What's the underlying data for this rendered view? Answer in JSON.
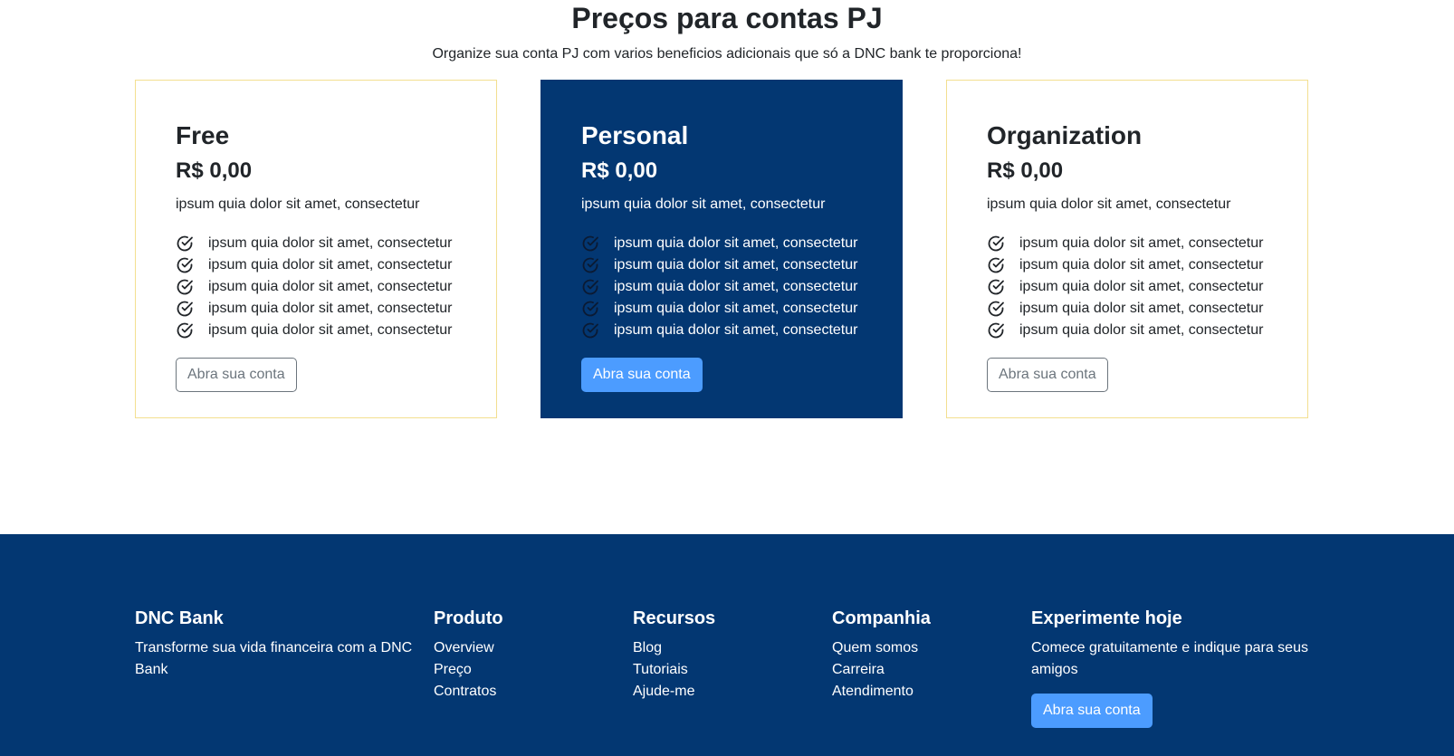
{
  "pricing": {
    "title": "Preços para contas PJ",
    "subtitle": "Organize sua conta PJ com varios beneficios adicionais que só a DNC bank te proporciona!",
    "plans": [
      {
        "name": "Free",
        "price": "R$ 0,00",
        "description": "ipsum quia dolor sit amet, consectetur",
        "features": [
          "ipsum quia dolor sit amet, consectetur",
          "ipsum quia dolor sit amet, consectetur",
          "ipsum quia dolor sit amet, consectetur",
          "ipsum quia dolor sit amet, consectetur",
          "ipsum quia dolor sit amet, consectetur"
        ],
        "button_label": "Abra sua conta"
      },
      {
        "name": "Personal",
        "price": "R$ 0,00",
        "description": "ipsum quia dolor sit amet, consectetur",
        "features": [
          "ipsum quia dolor sit amet, consectetur",
          "ipsum quia dolor sit amet, consectetur",
          "ipsum quia dolor sit amet, consectetur",
          "ipsum quia dolor sit amet, consectetur",
          "ipsum quia dolor sit amet, consectetur"
        ],
        "button_label": "Abra sua conta"
      },
      {
        "name": "Organization",
        "price": "R$ 0,00",
        "description": "ipsum quia dolor sit amet, consectetur",
        "features": [
          "ipsum quia dolor sit amet, consectetur",
          "ipsum quia dolor sit amet, consectetur",
          "ipsum quia dolor sit amet, consectetur",
          "ipsum quia dolor sit amet, consectetur",
          "ipsum quia dolor sit amet, consectetur"
        ],
        "button_label": "Abra sua conta"
      }
    ],
    "icons": {
      "feature": "check-circle-icon"
    }
  },
  "footer": {
    "brand": {
      "title": "DNC Bank",
      "text": "Transforme sua vida financeira com a DNC Bank"
    },
    "produto": {
      "title": "Produto",
      "links": [
        "Overview",
        "Preço",
        "Contratos"
      ]
    },
    "recursos": {
      "title": "Recursos",
      "links": [
        "Blog",
        "Tutoriais",
        "Ajude-me"
      ]
    },
    "companhia": {
      "title": "Companhia",
      "links": [
        "Quem somos",
        "Carreira",
        "Atendimento"
      ]
    },
    "cta": {
      "title": "Experimente hoje",
      "text": "Comece gratuitamente e indique para seus amigos",
      "button_label": "Abra sua conta"
    }
  },
  "colors": {
    "primary_dark": "#033772",
    "accent_button": "#4c9cff",
    "card_border": "#f3df90"
  }
}
